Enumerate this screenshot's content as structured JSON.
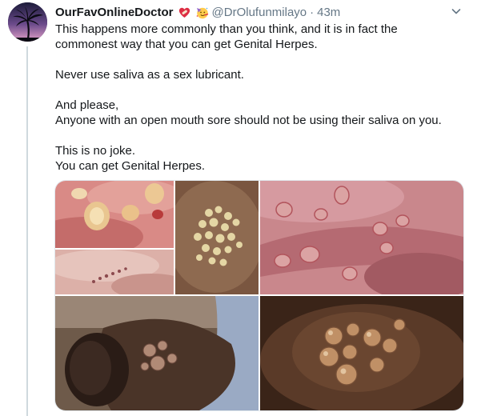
{
  "tweet": {
    "author_name": "OurFavOnlineDoctor",
    "badges": [
      "heart-with-bandage-emoji",
      "partying-face-emoji"
    ],
    "handle": "@DrOlufunmilayo",
    "separator": "·",
    "time": "43m",
    "avatar": "palm-tree-avatar",
    "lines": [
      "This happens more commonly than you think, and it is in fact the",
      "commonest way that you can get Genital Herpes.",
      "",
      "Never use saliva as a sex lubricant.",
      "",
      "And please,",
      "Anyone with an open mouth sore should not be using their saliva on you.",
      "",
      "This is no joke.",
      "You can get Genital Herpes."
    ],
    "media": {
      "count": 6,
      "photos": [
        "clinical-photo-lip-blisters",
        "clinical-photo-skin-crusted-lesions",
        "clinical-photo-clustered-vesicles",
        "clinical-photo-mucosal-ulcers",
        "clinical-photo-penile-blisters",
        "clinical-photo-skin-vesicle-cluster"
      ]
    }
  },
  "colors": {
    "text": "#14171a",
    "secondary": "#657786",
    "border": "#e1e8ed",
    "thread_line": "#cfd9de"
  }
}
